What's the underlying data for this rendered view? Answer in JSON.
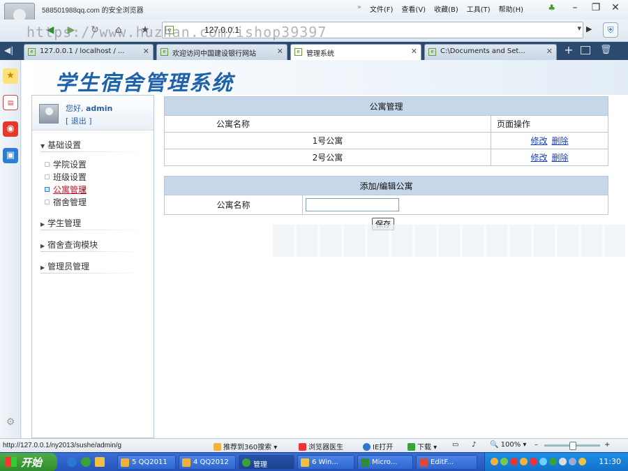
{
  "browser": {
    "title": "588501988qq.com 的安全浏览器",
    "menu": [
      "文件(F)",
      "查看(V)",
      "收藏(B)",
      "工具(T)",
      "帮助(H)"
    ],
    "url": "127.0.0.1",
    "watermark": "https://www.huzhan.com/ishop39397",
    "tabs": [
      {
        "label": "127.0.0.1 / localhost / ..."
      },
      {
        "label": "欢迎访问中国建设银行网站"
      },
      {
        "label": "管理系统"
      },
      {
        "label": "C:\\Documents and Set..."
      }
    ],
    "status_url": "http://127.0.0.1/ny2013/sushe/admin/g",
    "status_items": [
      "推荐到360搜索",
      "浏览器医生",
      "IE打开",
      "下载"
    ],
    "zoom": "100%"
  },
  "app": {
    "logo": "学生宿舍管理系统",
    "user": {
      "greeting": "您好,",
      "name": "admin",
      "logout": "[ 退出 ]"
    },
    "menu": {
      "basic": "基础设置",
      "basic_items": [
        "学院设置",
        "班级设置",
        "公寓管理",
        "宿舍管理"
      ],
      "student": "学生管理",
      "query": "宿舍查询模块",
      "admin": "管理员管理"
    }
  },
  "list": {
    "title": "公寓管理",
    "col_name": "公寓名称",
    "col_ops": "页面操作",
    "rows": [
      {
        "name": "1号公寓",
        "edit": "修改",
        "del": "删除"
      },
      {
        "name": "2号公寓",
        "edit": "修改",
        "del": "删除"
      }
    ]
  },
  "form": {
    "title": "添加/编辑公寓",
    "label": "公寓名称",
    "value": "",
    "save": "保存"
  },
  "taskbar": {
    "start": "开始",
    "items": [
      "5 QQ2011",
      "4 QQ2012",
      "管理",
      "6 Win...",
      "Micro...",
      "EditF..."
    ],
    "clock": "11:30"
  }
}
